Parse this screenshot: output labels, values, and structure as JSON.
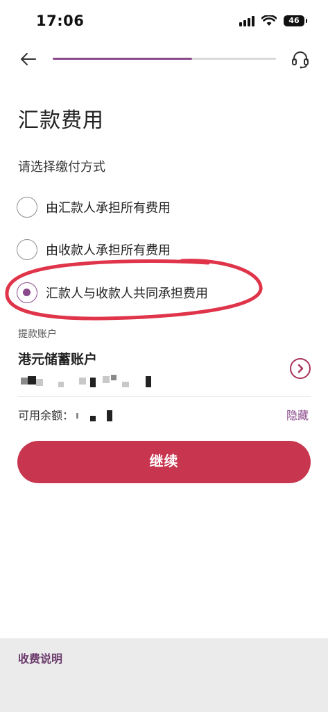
{
  "status_bar": {
    "time": "17:06",
    "battery_level": "46",
    "icons": [
      "signal-icon",
      "wifi-icon",
      "battery-icon"
    ]
  },
  "nav": {
    "back_icon": "arrow-left-icon",
    "support_icon": "headset-icon",
    "progress_fraction": 0.625
  },
  "page": {
    "title": "汇款费用",
    "prompt": "请选择缴付方式"
  },
  "options": [
    {
      "label": "由汇款人承担所有费用",
      "selected": false
    },
    {
      "label": "由收款人承担所有费用",
      "selected": false
    },
    {
      "label": "汇款人与收款人共同承担费用",
      "selected": true
    }
  ],
  "account": {
    "caption": "提款账户",
    "name": "港元储蓄账户",
    "balance_label": "可用余额：",
    "hide_label": "隐藏"
  },
  "actions": {
    "continue_label": "继续"
  },
  "footer": {
    "fee_link": "收费说明"
  },
  "colors": {
    "accent": "#8b4a8c",
    "primary_button": "#c8354f",
    "highlight_ink": "#e0344a",
    "footer_bg": "#ebebeb"
  }
}
